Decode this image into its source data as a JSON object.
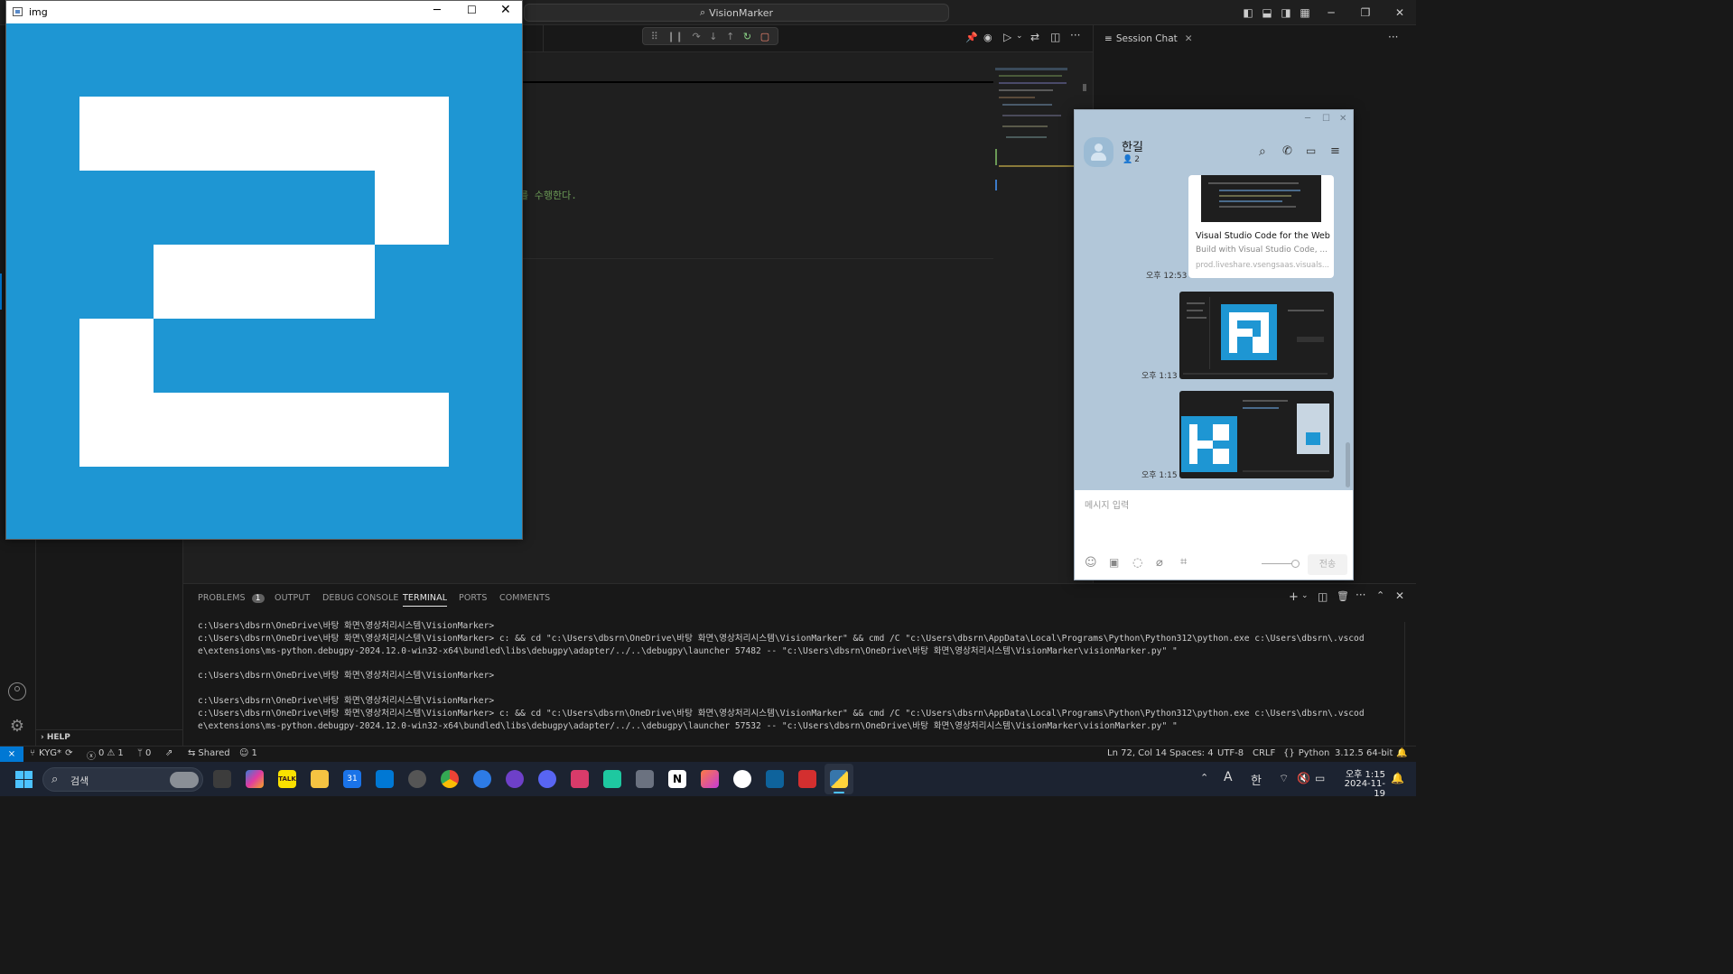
{
  "vscode": {
    "command_center": "VisionMarker",
    "editor_comment": "를 수행한다.",
    "chat_tab": "Session Chat",
    "panel": {
      "tabs": [
        "PROBLEMS",
        "OUTPUT",
        "DEBUG CONSOLE",
        "TERMINAL",
        "PORTS",
        "COMMENTS"
      ],
      "problems_count": "1",
      "active_tab": "TERMINAL"
    },
    "terminal_lines": [
      "c:\\Users\\dbsrn\\OneDrive\\바탕 화면\\영상처리시스템\\VisionMarker>",
      "c:\\Users\\dbsrn\\OneDrive\\바탕 화면\\영상처리시스템\\VisionMarker> c: && cd \"c:\\Users\\dbsrn\\OneDrive\\바탕 화면\\영상처리시스템\\VisionMarker\" && cmd /C \"c:\\Users\\dbsrn\\AppData\\Local\\Programs\\Python\\Python312\\python.exe c:\\Users\\dbsrn\\.vscod",
      "e\\extensions\\ms-python.debugpy-2024.12.0-win32-x64\\bundled\\libs\\debugpy\\adapter/../..\\debugpy\\launcher 57482 -- \"c:\\Users\\dbsrn\\OneDrive\\바탕 화면\\영상처리시스템\\VisionMarker\\visionMarker.py\" \"",
      "",
      "c:\\Users\\dbsrn\\OneDrive\\바탕 화면\\영상처리시스템\\VisionMarker>",
      "",
      "c:\\Users\\dbsrn\\OneDrive\\바탕 화면\\영상처리시스템\\VisionMarker>",
      "c:\\Users\\dbsrn\\OneDrive\\바탕 화면\\영상처리시스템\\VisionMarker> c: && cd \"c:\\Users\\dbsrn\\OneDrive\\바탕 화면\\영상처리시스템\\VisionMarker\" && cmd /C \"c:\\Users\\dbsrn\\AppData\\Local\\Programs\\Python\\Python312\\python.exe c:\\Users\\dbsrn\\.vscod",
      "e\\extensions\\ms-python.debugpy-2024.12.0-win32-x64\\bundled\\libs\\debugpy\\adapter/../..\\debugpy\\launcher 57532 -- \"c:\\Users\\dbsrn\\OneDrive\\바탕 화면\\영상처리시스템\\VisionMarker\\visionMarker.py\" \""
    ],
    "sidebar_help": "HELP",
    "status": {
      "branch": "KYG*",
      "errors": "0",
      "warnings": "1",
      "ports": "0",
      "shared": "Shared",
      "participants": "1",
      "position": "Ln 72, Col 14",
      "spaces": "Spaces: 4",
      "encoding": "UTF-8",
      "eol": "CRLF",
      "language": "Python",
      "interpreter": "3.12.5 64-bit"
    }
  },
  "img_window": {
    "title": "img"
  },
  "kakao": {
    "contact_name": "한길",
    "member_count": "2",
    "messages": [
      {
        "time": "오후 12:53",
        "link_title": "Visual Studio Code for the Web",
        "link_desc": "Build with Visual Studio Code, ...",
        "link_url": "prod.liveshare.vsengsaas.visuals..."
      },
      {
        "time": "오후 1:13"
      },
      {
        "time": "오후 1:15"
      }
    ],
    "input_placeholder": "메시지 입력",
    "send_label": "전송"
  },
  "taskbar": {
    "search_placeholder": "검색",
    "clock_time": "오후 1:15",
    "clock_date": "2024-11-19",
    "ime_a": "A",
    "ime_ko": "한",
    "calendar_day": "31"
  },
  "colors": {
    "marker_blue": "#1e96d3",
    "vscode_bg": "#1f1f1f",
    "kakao_bg": "#b2c7d9",
    "taskbar_bg": "#1c2331"
  }
}
